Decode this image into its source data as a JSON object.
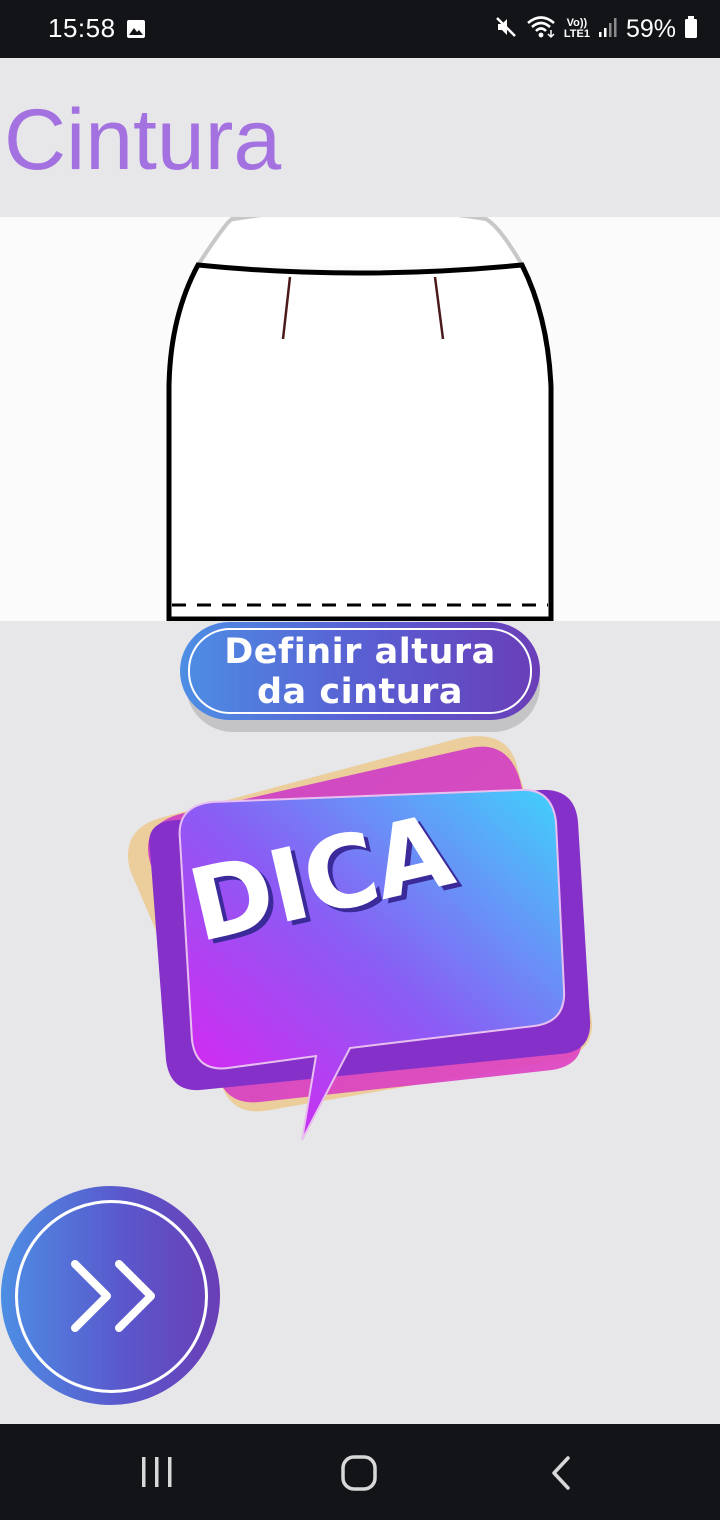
{
  "status_bar": {
    "time": "15:58",
    "battery": "59%",
    "network_top": "Vo))",
    "network_bottom": "LTE1",
    "icons": [
      "gallery-icon",
      "mute-icon",
      "wifi-icon",
      "signal-icon",
      "battery-icon"
    ]
  },
  "page": {
    "title": "Cintura",
    "title_color": "#a472e0"
  },
  "illustration": {
    "icon": "skirt-icon"
  },
  "define_button": {
    "line1": "Definir altura",
    "line2": "da cintura"
  },
  "dica": {
    "label": "DICA",
    "icon": "speech-bubble-icon"
  },
  "next_button": {
    "icon": "double-chevron-right-icon"
  },
  "nav_bar": {
    "icons": [
      "recent-apps-icon",
      "home-icon",
      "back-icon"
    ]
  },
  "colors": {
    "accent_gradient_start": "#4d8ee4",
    "accent_gradient_end": "#6a3eb8",
    "background": "#e7e7e9"
  }
}
